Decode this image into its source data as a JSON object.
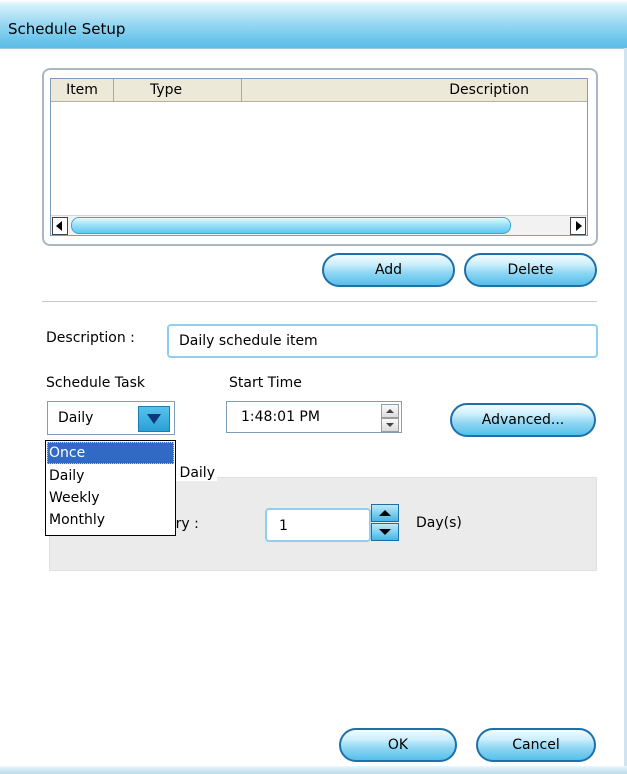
{
  "window": {
    "title": "Schedule Setup"
  },
  "table": {
    "columns": [
      "Item",
      "Type",
      "Description"
    ],
    "rows": []
  },
  "buttons": {
    "add": "Add",
    "delete": "Delete",
    "advanced": "Advanced...",
    "ok": "OK",
    "cancel": "Cancel"
  },
  "form": {
    "description_label": "Description :",
    "description_value": "Daily schedule item",
    "schedule_task_label": "Schedule Task",
    "schedule_task_value": "Daily",
    "start_time_label": "Start Time",
    "start_time_value": "1:48:01 PM"
  },
  "dropdown": {
    "options": [
      "Once",
      "Daily",
      "Weekly",
      "Monthly"
    ],
    "highlighted": "Once"
  },
  "group": {
    "title_partial": "k Daily",
    "every_partial": "ery :",
    "every_value": "1",
    "unit": "Day(s)"
  },
  "colors": {
    "title_gradient_end": "#5cbde6",
    "pill_border": "#1f6fa8",
    "selection": "#316ac5"
  }
}
